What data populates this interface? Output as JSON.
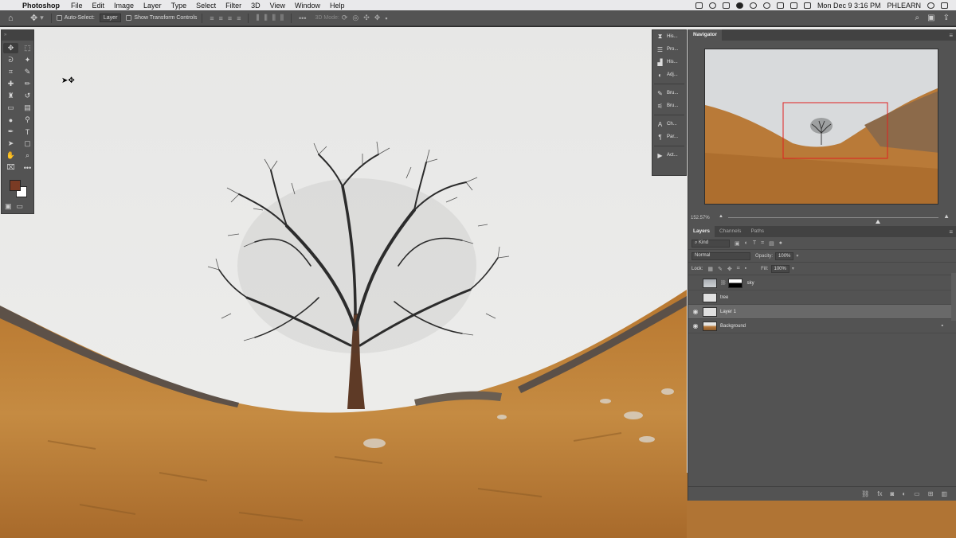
{
  "menubar": {
    "apple_icon": "apple-logo-icon",
    "app_name": "Photoshop",
    "items": [
      "File",
      "Edit",
      "Image",
      "Layer",
      "Type",
      "Select",
      "Filter",
      "3D",
      "View",
      "Window",
      "Help"
    ],
    "clock": "Mon Dec 9  3:16 PM",
    "user": "PHLEARN"
  },
  "options_bar": {
    "auto_select_label": "Auto-Select:",
    "auto_select_value": "Layer",
    "transform_label": "Show Transform Controls",
    "three_d_label": "3D Mode:"
  },
  "tools": {
    "foreground_color": "#7a3b24",
    "background_color": "#ffffff"
  },
  "panel_strip": {
    "items": [
      "His...",
      "Pro...",
      "His...",
      "Adj...",
      "Bru...",
      "Bru...",
      "Ch...",
      "Par...",
      "Act..."
    ]
  },
  "navigator": {
    "tab": "Navigator",
    "zoom": "152.57%"
  },
  "layers_panel": {
    "tabs": [
      "Layers",
      "Channels",
      "Paths"
    ],
    "filter_kind": "Kind",
    "blend_mode": "Normal",
    "opacity_label": "Opacity:",
    "opacity_value": "100%",
    "lock_label": "Lock:",
    "fill_label": "Fill:",
    "fill_value": "100%",
    "layers": [
      {
        "name": "sky",
        "visible": false
      },
      {
        "name": "tree",
        "visible": false
      },
      {
        "name": "Layer 1",
        "visible": true
      },
      {
        "name": "Background",
        "visible": true
      }
    ]
  }
}
